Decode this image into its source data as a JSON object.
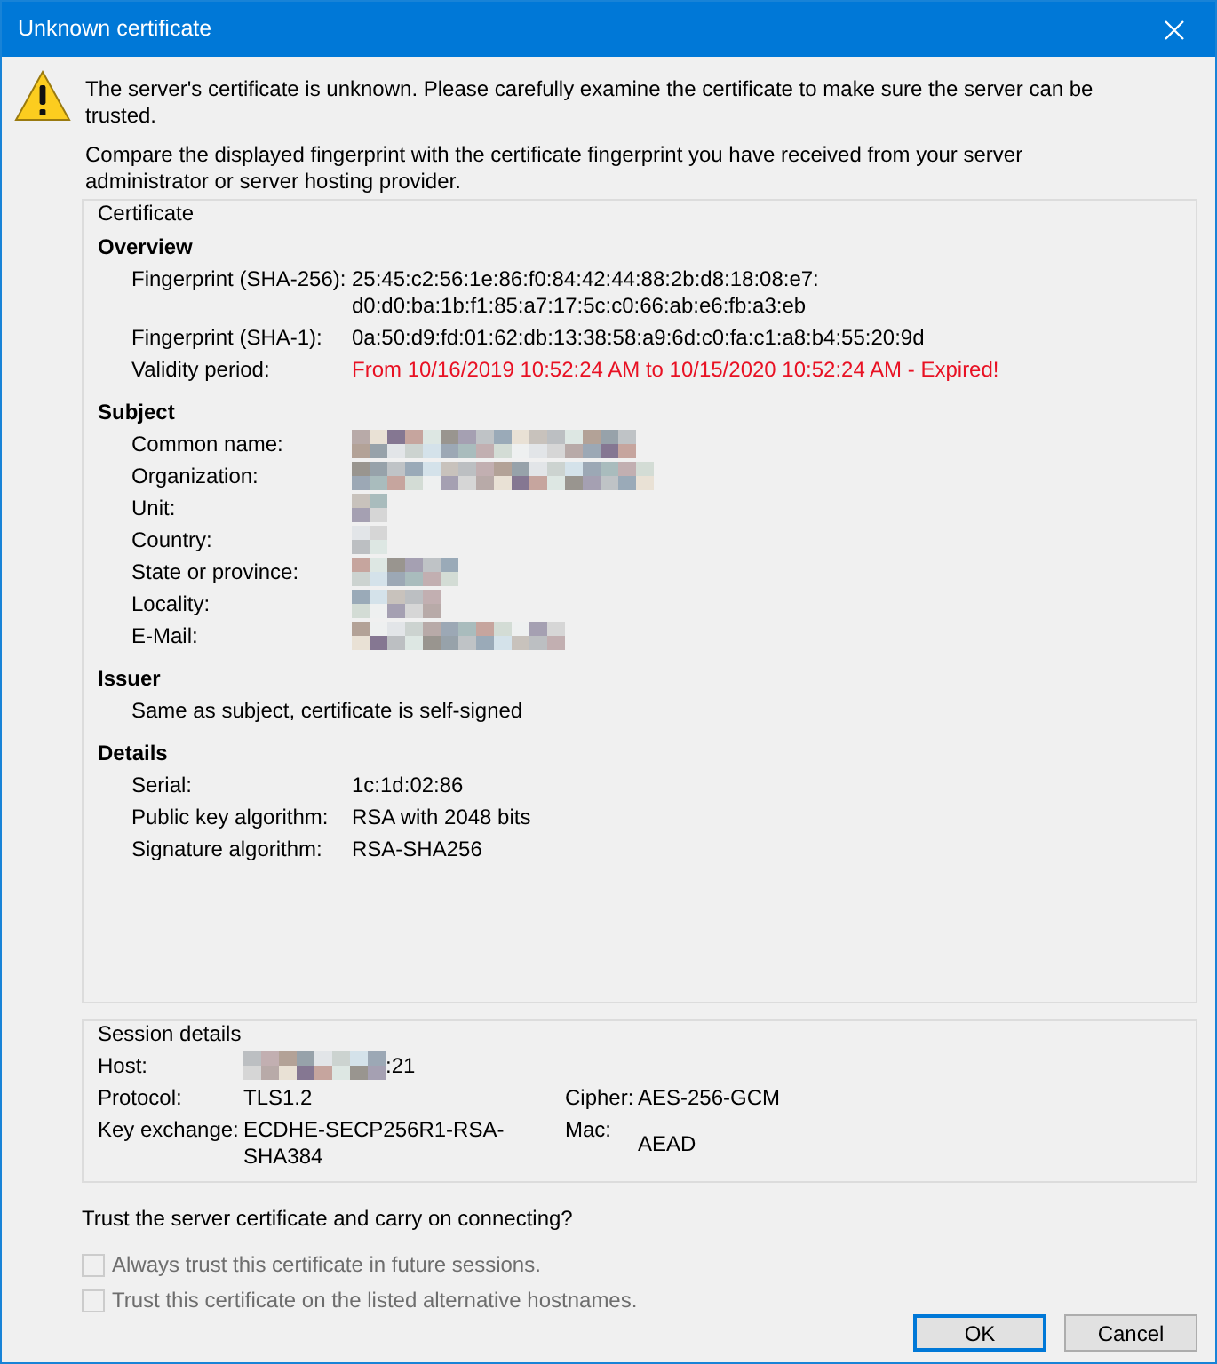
{
  "window": {
    "title": "Unknown certificate"
  },
  "message": "The server's certificate is unknown. Please carefully examine the certificate to make sure the server can be trusted.",
  "instructions": "Compare the displayed fingerprint with the certificate fingerprint you have received from your server administrator or server hosting provider.",
  "certificate": {
    "title": "Certificate",
    "sections": [
      {
        "heading": "Overview",
        "fields": [
          {
            "kind": "text",
            "label": "Fingerprint (SHA-256):",
            "value": "25:45:c2:56:1e:86:f0:84:42:44:88:2b:d8:18:08:e7:\nd0:d0:ba:1b:f1:85:a7:17:5c:c0:66:ab:e6:fb:a3:eb"
          },
          {
            "kind": "text",
            "label": "Fingerprint (SHA-1):",
            "value": "0a:50:d9:fd:01:62:db:13:38:58:a9:6d:c0:fa:c1:a8:b4:55:20:9d"
          },
          {
            "kind": "error",
            "label": "Validity period:",
            "value": "From 10/16/2019 10:52:24 AM to 10/15/2020 10:52:24 AM - Expired!"
          }
        ]
      },
      {
        "heading": "Subject",
        "fields": [
          {
            "kind": "redacted",
            "label": "Common name:"
          },
          {
            "kind": "redacted",
            "label": "Organization:"
          },
          {
            "kind": "redacted",
            "label": "Unit:"
          },
          {
            "kind": "redacted",
            "label": "Country:"
          },
          {
            "kind": "redacted",
            "label": "State or province:"
          },
          {
            "kind": "redacted",
            "label": "Locality:"
          },
          {
            "kind": "redacted",
            "label": "E-Mail:"
          }
        ]
      },
      {
        "heading": "Issuer",
        "note": "Same as subject, certificate is self-signed"
      },
      {
        "heading": "Details",
        "fields": [
          {
            "kind": "text",
            "label": "Serial:",
            "value": "1c:1d:02:86"
          },
          {
            "kind": "text",
            "label": "Public key algorithm:",
            "value": "RSA with 2048 bits"
          },
          {
            "kind": "text",
            "label": "Signature algorithm:",
            "value": "RSA-SHA256"
          }
        ]
      }
    ]
  },
  "session": {
    "title": "Session details",
    "rows": [
      [
        {
          "kind": "partly_redacted",
          "label": "Host:",
          "value": ":21"
        }
      ],
      [
        {
          "kind": "text",
          "label": "Protocol:",
          "value": "TLS1.2"
        },
        {
          "kind": "text",
          "label": "Cipher:",
          "value": "AES-256-GCM"
        }
      ],
      [
        {
          "kind": "text",
          "label": "Key exchange:",
          "value": "ECDHE-SECP256R1-RSA-SHA384"
        },
        {
          "kind": "text",
          "label": "Mac:",
          "value": "AEAD"
        }
      ]
    ]
  },
  "question": "Trust the server certificate and carry on connecting?",
  "options": [
    {
      "label": "Always trust this certificate in future sessions.",
      "checked": false,
      "disabled": true
    },
    {
      "label": "Trust this certificate on the listed alternative hostnames.",
      "checked": false,
      "disabled": true
    }
  ],
  "buttons": [
    {
      "label": "OK",
      "default": true
    },
    {
      "label": "Cancel",
      "default": false
    }
  ]
}
